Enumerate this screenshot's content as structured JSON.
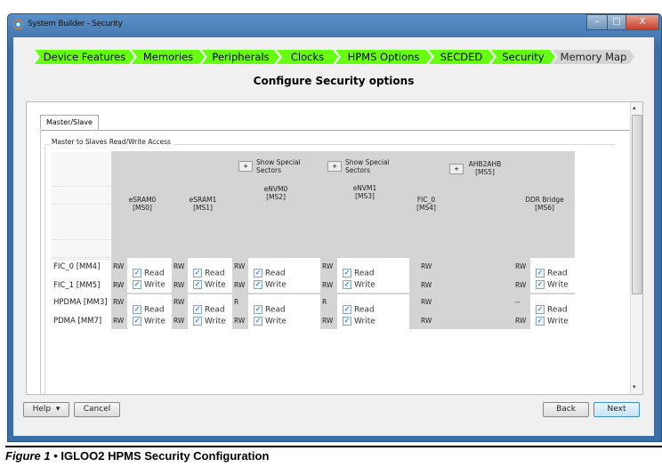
{
  "window": {
    "title": "System Builder - Security",
    "minimize": "–",
    "maximize": "□",
    "close": "X"
  },
  "steps": [
    {
      "label": "Device Features",
      "done": true
    },
    {
      "label": "Memories",
      "done": true
    },
    {
      "label": "Peripherals",
      "done": true
    },
    {
      "label": "Clocks",
      "done": true
    },
    {
      "label": "HPMS Options",
      "done": true
    },
    {
      "label": "SECDED",
      "done": true
    },
    {
      "label": "Security",
      "done": true
    },
    {
      "label": "Memory Map",
      "done": false
    }
  ],
  "heading": "Configure Security options",
  "tab": "Master/Slave",
  "group_title": "Master to Slaves Read/Write Access",
  "show_special": "Show Special Sectors",
  "expand_btn": "+",
  "masters": [
    "FIC_0 [MM4]",
    "FIC_1 [MM5]",
    "HPDMA [MM3]",
    "PDMA [MM7]"
  ],
  "slaves": [
    {
      "name": "eSRAM0",
      "id": "[MS0]",
      "rw": [
        "RW",
        "RW",
        "RW",
        "RW"
      ],
      "perms": [
        {
          "read": true,
          "write": true
        },
        {
          "read": true,
          "write": true
        }
      ]
    },
    {
      "name": "eSRAM1",
      "id": "[MS1]",
      "rw": [
        "RW",
        "RW",
        "RW",
        "RW"
      ],
      "perms": [
        {
          "read": true,
          "write": true
        },
        {
          "read": true,
          "write": true
        }
      ]
    },
    {
      "name": "eNVM0",
      "id": "[MS2]",
      "rw": [
        "RW",
        "RW",
        "R",
        "RW"
      ],
      "special": true,
      "perms": [
        {
          "read": true,
          "write": true
        },
        {
          "read": true,
          "write": true
        }
      ]
    },
    {
      "name": "eNVM1",
      "id": "[MS3]",
      "rw": [
        "RW",
        "RW",
        "R",
        "RW"
      ],
      "special": true,
      "perms": [
        {
          "read": true,
          "write": true
        },
        {
          "read": true,
          "write": true
        }
      ]
    },
    {
      "name": "FIC_0",
      "id": "[MS4]",
      "rw": [
        "RW",
        "RW",
        "RW",
        "RW"
      ]
    },
    {
      "name": "AHB2AHB",
      "id": "[MS5]",
      "expand": true
    },
    {
      "name": "DDR Bridge",
      "id": "[MS6]",
      "rw": [
        "RW",
        "RW",
        "--",
        "RW"
      ],
      "perms": [
        {
          "read": true,
          "write": true
        },
        {
          "read": true,
          "write": true
        }
      ]
    }
  ],
  "check_labels": {
    "read": "Read",
    "write": "Write"
  },
  "buttons": {
    "help": "Help",
    "help_arrow": "▾",
    "cancel": "Cancel",
    "back": "Back",
    "next": "Next"
  },
  "caption": {
    "fig": "Figure 1",
    "sep": " • ",
    "text": "IGLOO2 HPMS Security Configuration"
  }
}
